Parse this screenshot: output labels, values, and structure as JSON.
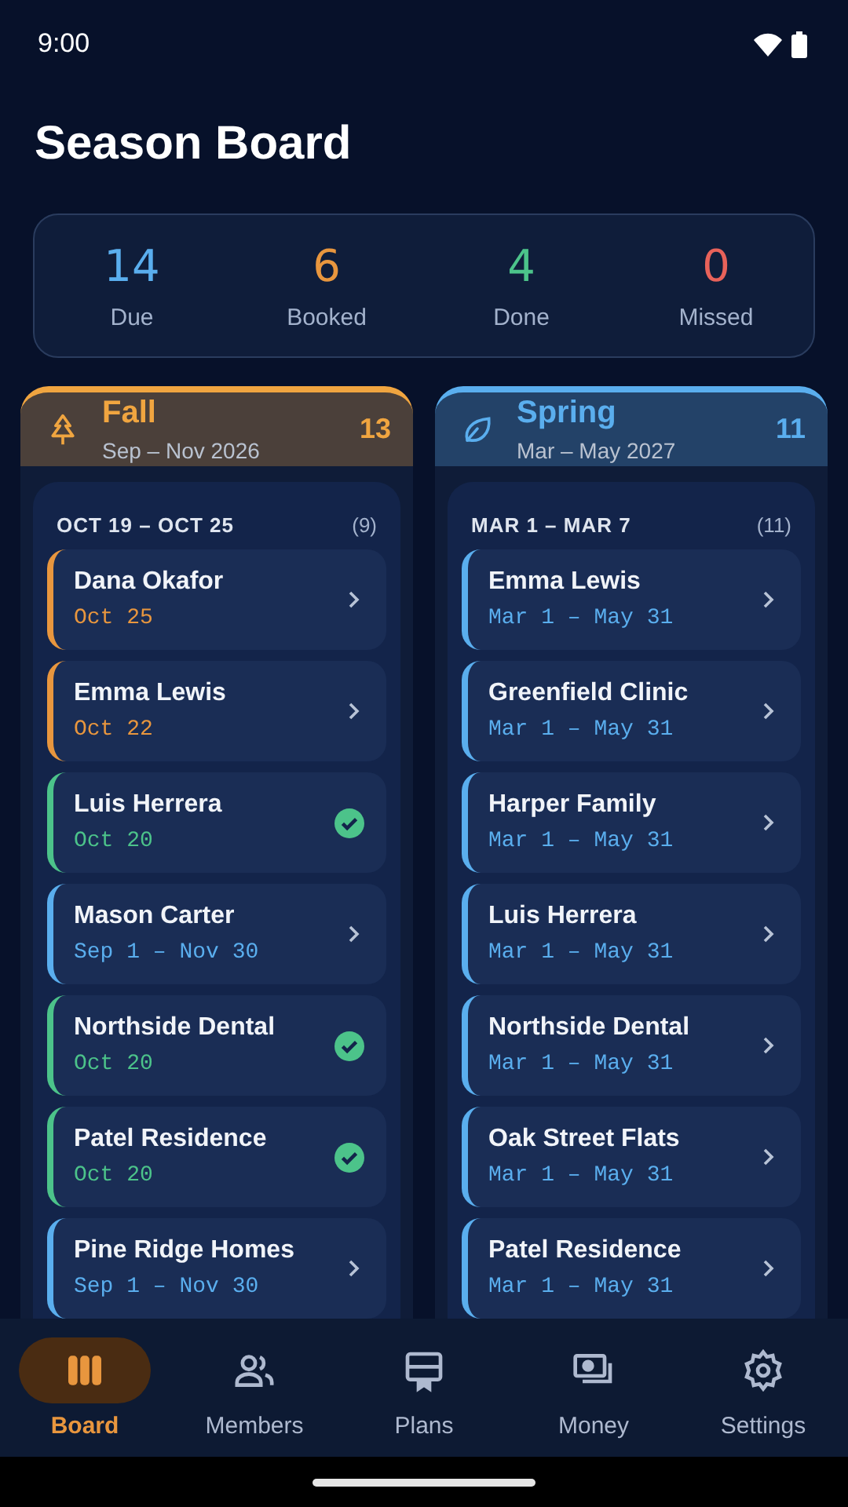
{
  "status_bar": {
    "time": "9:00"
  },
  "title": "Season Board",
  "stats": [
    {
      "value": "14",
      "label": "Due",
      "color": "#5aaeee"
    },
    {
      "value": "6",
      "label": "Booked",
      "color": "#e8963e"
    },
    {
      "value": "4",
      "label": "Done",
      "color": "#4cc38a"
    },
    {
      "value": "0",
      "label": "Missed",
      "color": "#e8625a"
    }
  ],
  "columns": [
    {
      "kind": "fall",
      "name": "Fall",
      "range": "Sep – Nov 2026",
      "count": "13",
      "color": "#f0a540",
      "group": {
        "label": "OCT 19 – OCT 25",
        "count": "(9)"
      },
      "cards": [
        {
          "name": "Dana Okafor",
          "date": "Oct 25",
          "color": "#e8963e",
          "done": false
        },
        {
          "name": "Emma Lewis",
          "date": "Oct 22",
          "color": "#e8963e",
          "done": false
        },
        {
          "name": "Luis Herrera",
          "date": "Oct 20",
          "color": "#4cc38a",
          "done": true
        },
        {
          "name": "Mason Carter",
          "date": "Sep 1 – Nov 30",
          "color": "#5aaeee",
          "done": false
        },
        {
          "name": "Northside Dental",
          "date": "Oct 20",
          "color": "#4cc38a",
          "done": true
        },
        {
          "name": "Patel Residence",
          "date": "Oct 20",
          "color": "#4cc38a",
          "done": true
        },
        {
          "name": "Pine Ridge Homes",
          "date": "Sep 1 – Nov 30",
          "color": "#5aaeee",
          "done": false
        }
      ]
    },
    {
      "kind": "spring",
      "name": "Spring",
      "range": "Mar – May 2027",
      "count": "11",
      "color": "#5aaeee",
      "group": {
        "label": "MAR 1 – MAR 7",
        "count": "(11)"
      },
      "cards": [
        {
          "name": "Emma Lewis",
          "date": "Mar 1 – May 31",
          "color": "#5aaeee",
          "done": false
        },
        {
          "name": "Greenfield Clinic",
          "date": "Mar 1 – May 31",
          "color": "#5aaeee",
          "done": false
        },
        {
          "name": "Harper Family",
          "date": "Mar 1 – May 31",
          "color": "#5aaeee",
          "done": false
        },
        {
          "name": "Luis Herrera",
          "date": "Mar 1 – May 31",
          "color": "#5aaeee",
          "done": false
        },
        {
          "name": "Northside Dental",
          "date": "Mar 1 – May 31",
          "color": "#5aaeee",
          "done": false
        },
        {
          "name": "Oak Street Flats",
          "date": "Mar 1 – May 31",
          "color": "#5aaeee",
          "done": false
        },
        {
          "name": "Patel Residence",
          "date": "Mar 1 – May 31",
          "color": "#5aaeee",
          "done": false
        }
      ]
    }
  ],
  "nav": [
    {
      "kind": "board",
      "label": "Board",
      "selected": true
    },
    {
      "kind": "members",
      "label": "Members",
      "selected": false
    },
    {
      "kind": "plans",
      "label": "Plans",
      "selected": false
    },
    {
      "kind": "money",
      "label": "Money",
      "selected": false
    },
    {
      "kind": "settings",
      "label": "Settings",
      "selected": false
    }
  ]
}
